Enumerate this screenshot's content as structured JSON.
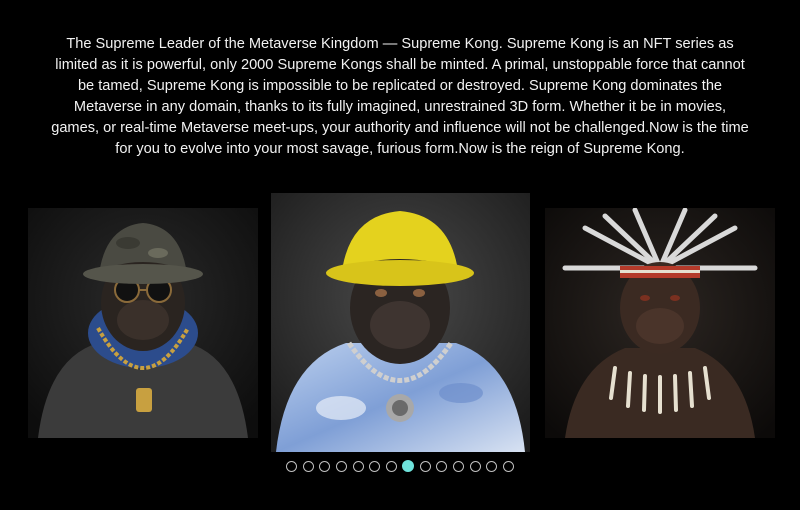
{
  "intro": {
    "text": "The Supreme Leader of the Metaverse Kingdom — Supreme Kong. Supreme Kong is an NFT series as limited as it is powerful, only 2000 Supreme Kongs shall be minted. A primal, unstoppable force that cannot be tamed, Supreme Kong is impossible to be replicated or destroyed. Supreme Kong dominates the Metaverse in any domain, thanks to its fully imagined, unrestrained 3D form. Whether it be in movies, games, or real-time Metaverse meet-ups, your authority and influence will not be challenged.Now is the time for you to evolve into your most savage, furious form.Now is the reign of Supreme Kong."
  },
  "carousel": {
    "slides": [
      {
        "name": "camo-bucket-hat-kong",
        "hat_color": "#4a4a42",
        "shirt_color": "#3a3a3a",
        "fur_accent": "#2f4f8f"
      },
      {
        "name": "yellow-bucket-hat-kong",
        "hat_color": "#e4d21e",
        "shirt_color": "#9fb8e0",
        "fur_accent": "#2b2522"
      },
      {
        "name": "feather-headdress-kong",
        "hat_color": "#cfcfcf",
        "shirt_color": "#3a2a22",
        "fur_accent": "#3b2a22"
      }
    ],
    "dot_count": 14,
    "active_index": 7,
    "active_color": "#6fe3dc",
    "inactive_color": "#bfbfbf"
  }
}
